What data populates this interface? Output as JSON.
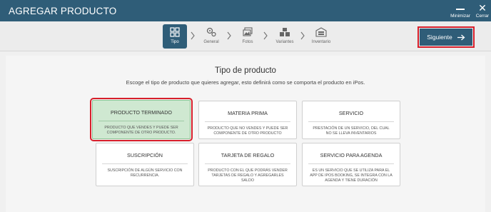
{
  "window": {
    "title": "AGREGAR PRODUCTO",
    "minimize_label": "Minimizar",
    "close_label": "Cerrar"
  },
  "steps": [
    {
      "label": "Tipo",
      "icon": "grid-icon",
      "active": true
    },
    {
      "label": "General",
      "icon": "gears-icon",
      "active": false
    },
    {
      "label": "Fotos",
      "icon": "photos-icon",
      "active": false
    },
    {
      "label": "Variantes",
      "icon": "boxes-icon",
      "active": false
    },
    {
      "label": "Inventario",
      "icon": "warehouse-icon",
      "active": false
    }
  ],
  "next_button": {
    "label": "Siguiente",
    "icon": "arrow-right-icon"
  },
  "main": {
    "title": "Tipo de producto",
    "subtitle": "Escoge el tipo de producto que quieres agregar, esto definirá como se comporta el producto en iPos."
  },
  "product_types": [
    {
      "title": "PRODUCTO TERMINADO",
      "description": "PRODUCTO QUE VENDES Y PUEDE SER COMPONENTE DE OTRO PRODUCTO.",
      "selected": true
    },
    {
      "title": "MATERIA PRIMA",
      "description": "PRODUCTO QUE NO VENDES Y PUEDE SER COMPONENTE DE OTRO PRODUCTO",
      "selected": false
    },
    {
      "title": "SERVICIO",
      "description": "PRESTACIÓN DE UN SERVICIO, DEL CUAL NO SE LLEVA INVENTARIOS",
      "selected": false
    },
    {
      "title": "SUSCRIPCIÓN",
      "description": "SUSCRIPCIÓN DE ALGÚN SERVICIO CON RECURRENCIA.",
      "selected": false
    },
    {
      "title": "TARJETA DE REGALO",
      "description": "PRODUCTO CON EL QUE PODRÁS VENDER TARJETAS DE REGALO Y AGREGARLES SALDO",
      "selected": false
    },
    {
      "title": "SERVICIO PARA AGENDA",
      "description": "ES UN SERVICIO QUE SE UTILIZA PARA EL APP DE IPOS BOOKING, SE INTEGRA CON LA AGENDA Y TIENE DURACIÓN",
      "selected": false
    }
  ],
  "colors": {
    "primary": "#2f5d78",
    "selected_card": "#cfe8d1",
    "highlight": "#d71f2b"
  }
}
